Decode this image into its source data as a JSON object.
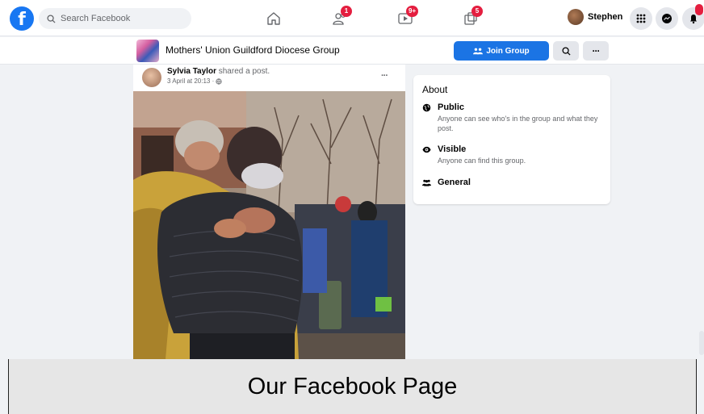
{
  "nav": {
    "logo_letter": "f",
    "search_placeholder": "Search Facebook",
    "badges": {
      "friends": "1",
      "watch": "9+",
      "gaming": "5"
    },
    "profile_name": "Stephen"
  },
  "group": {
    "name": "Mothers' Union Guildford Diocese Group",
    "join_label": "Join Group",
    "more_label": "···"
  },
  "post": {
    "author": "Sylvia Taylor",
    "action": "shared a post.",
    "date": "3 April at 20:13 · ",
    "more_label": "···"
  },
  "about": {
    "title": "About",
    "items": [
      {
        "icon": "globe-icon",
        "title": "Public",
        "desc": "Anyone can see who's in the group and what they post."
      },
      {
        "icon": "eye-icon",
        "title": "Visible",
        "desc": "Anyone can find this group."
      },
      {
        "icon": "people-icon",
        "title": "General",
        "desc": ""
      }
    ]
  },
  "caption": "Our Facebook Page",
  "colors": {
    "brand_blue": "#1877f2",
    "join_button": "#1b74e4",
    "badge_red": "#e41e3f",
    "bg": "#f0f2f5"
  }
}
